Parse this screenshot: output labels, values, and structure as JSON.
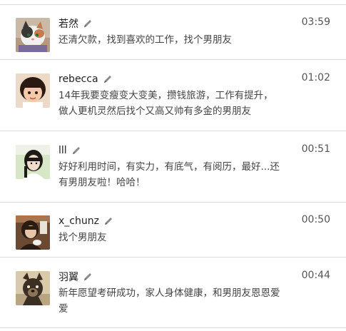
{
  "entries": [
    {
      "name": "若然",
      "time": "03:59",
      "lines": [
        "还清欠款，找到喜欢的工作，找个男朋友"
      ],
      "avatar": "avatar-cat",
      "colors": {
        "bg": "#c9b9a6",
        "a": "#f2f0ec",
        "b": "#3a3836",
        "c": "#c27c4e"
      }
    },
    {
      "name": "rebecca",
      "time": "01:02",
      "lines": [
        "14年我要变瘦变大变美，攒钱旅游，工作有提升，",
        "做人更机灵然后找个又高又帅有多金的男朋友"
      ],
      "avatar": "avatar-girl-cartoon",
      "colors": {
        "bg": "#ecd9c7",
        "a": "#2b1a12",
        "b": "#f4c9a8",
        "c": "#ffffff"
      }
    },
    {
      "name": "lll",
      "time": "00:51",
      "lines": [
        "好好利用时间，有实力，有底气，有阅历，最好...还",
        "有男朋友啦！哈哈！"
      ],
      "avatar": "avatar-girl-photo",
      "colors": {
        "bg": "#d8e6c8",
        "a": "#1d1a18",
        "b": "#f1dccb",
        "c": "#ffffff"
      }
    },
    {
      "name": "x_chunz",
      "time": "00:50",
      "lines": [
        "找个男朋友"
      ],
      "avatar": "avatar-cafe",
      "colors": {
        "bg": "#6b4a33",
        "a": "#2a1c14",
        "b": "#e7c6a8",
        "c": "#a8754f"
      }
    },
    {
      "name": "羽翼",
      "time": "00:44",
      "lines": [
        "新年愿望考研成功，家人身体健康，和男朋友恩恩爱",
        "爱"
      ],
      "avatar": "avatar-dog",
      "colors": {
        "bg": "#d9c9ad",
        "a": "#3b2e22",
        "b": "#8c7458",
        "c": "#f2ead9"
      }
    }
  ],
  "edit_icon": "pencil-icon"
}
